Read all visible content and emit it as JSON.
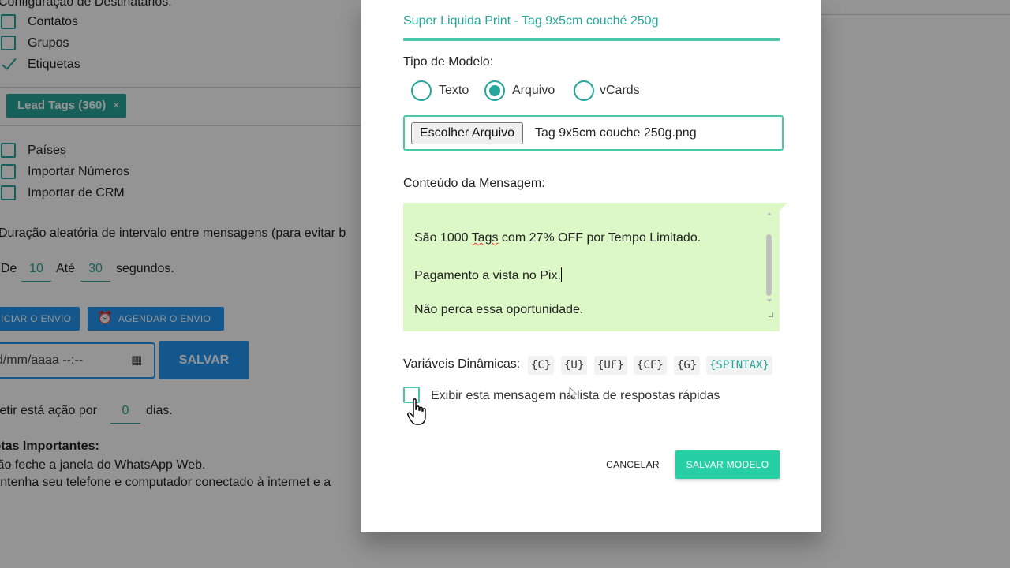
{
  "background": {
    "recipients_config_label": "Configuração de Destinatários:",
    "options": [
      {
        "label": "Contatos",
        "checked": false
      },
      {
        "label": "Grupos",
        "checked": false
      },
      {
        "label": "Etiquetas",
        "checked": true
      }
    ],
    "tag_chip": {
      "label": "Lead Tags (360)",
      "close": "×"
    },
    "more_options": [
      {
        "label": "Países",
        "checked": false
      },
      {
        "label": "Importar Números",
        "checked": false
      },
      {
        "label": "Importar de CRM",
        "checked": false
      }
    ],
    "interval_text": "Duração aleatória de intervalo entre mensagens (para evitar b",
    "interval": {
      "from_label": "De",
      "from_value": "10",
      "to_label": "Até",
      "to_value": "30",
      "unit": "segundos."
    },
    "start_button": "INICIAR O ENVIO",
    "schedule_button": "AGENDAR O ENVIO",
    "date_value": "dd/mm/aaaa --:--",
    "save_button": "SALVAR",
    "repeat": {
      "prefix": "Repetir está ação por",
      "value": "0",
      "suffix": "dias."
    },
    "notes_title": "Notas Importantes:",
    "notes": [
      "Não feche a janela do WhatsApp Web.",
      "Mantenha seu telefone e computador conectado à internet e a"
    ]
  },
  "modal": {
    "title": "Super Liquida Print - Tag 9x5cm couché 250g",
    "model_type_label": "Tipo de Modelo:",
    "model_types": [
      {
        "label": "Texto",
        "selected": false
      },
      {
        "label": "Arquivo",
        "selected": true
      },
      {
        "label": "vCards",
        "selected": false
      }
    ],
    "file_button": "Escolher Arquivo",
    "file_name": "Tag 9x5cm couche 250g.png",
    "content_label": "Conteúdo da Mensagem:",
    "message": {
      "line1_pre": "São 1000 ",
      "line1_spell": "Tags",
      "line1_post": " com 27% OFF por Tempo Limitado.",
      "line2": "Pagamento a vista no Pix.",
      "line3": "Não perca essa oportunidade."
    },
    "variables_label": "Variáveis Dinâmicas:",
    "variables": [
      "{C}",
      "{U}",
      "{UF}",
      "{CF}",
      "{G}",
      "{SPINTAX}"
    ],
    "quick_reply_label": "Exibir esta mensagem na lista de respostas rápidas",
    "quick_reply_checked": false,
    "cancel_button": "CANCELAR",
    "save_button": "SALVAR MODELO"
  },
  "colors": {
    "accent": "#26a69a",
    "primary_button": "#26d0a4",
    "message_bg": "#dcf8c6",
    "blue": "#2196f3"
  }
}
